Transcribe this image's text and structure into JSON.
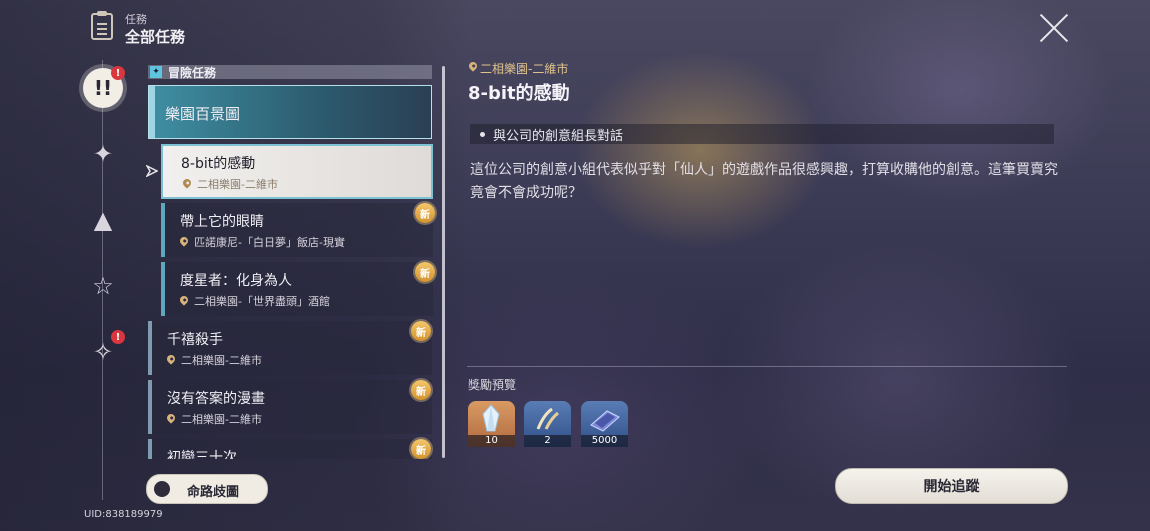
{
  "header": {
    "subtitle": "任務",
    "title": "全部任務"
  },
  "sidebar": [
    {
      "icon": "exclamation-icon",
      "glyph": "!!",
      "active": true,
      "alert": "!"
    },
    {
      "icon": "diamond-star-icon",
      "glyph": "✦",
      "active": false,
      "alert": ""
    },
    {
      "icon": "triangle-icon",
      "glyph": "▲",
      "active": false,
      "alert": ""
    },
    {
      "icon": "star-icon",
      "glyph": "☆",
      "active": false,
      "alert": ""
    },
    {
      "icon": "sparkle-icon",
      "glyph": "✧",
      "active": false,
      "alert": "!"
    }
  ],
  "list": {
    "section": "冒險任務",
    "items": [
      {
        "title": "樂園百景圖",
        "location": "",
        "new": false
      },
      {
        "title": "8-bit的感動",
        "location": "二相樂園-二維市",
        "new": false
      },
      {
        "title": "帶上它的眼睛",
        "location": "匹諾康尼-「白日夢」飯店-現實",
        "new": true,
        "badge": "新"
      },
      {
        "title": "度星者：化身為人",
        "location": "二相樂園-「世界盡頭」酒館",
        "new": true,
        "badge": "新"
      },
      {
        "title": "千禧殺手",
        "location": "二相樂園-二維市",
        "new": true,
        "badge": "新"
      },
      {
        "title": "沒有答案的漫畫",
        "location": "二相樂園-二維市",
        "new": true,
        "badge": "新"
      },
      {
        "title": "初戀三十次",
        "location": "",
        "new": true,
        "badge": "新"
      }
    ]
  },
  "route_button": "命路歧圖",
  "uid": "UID:838189979",
  "detail": {
    "location": "二相樂園-二維市",
    "title": "8-bit的感動",
    "objective": "與公司的創意組長對話",
    "description": "這位公司的創意小組代表似乎對「仙人」的遊戲作品很感興趣，打算收購他的創意。這筆買賣究竟會不會成功呢？",
    "rewards_label": "獎勵預覽",
    "rewards": [
      {
        "icon": "crystal-icon",
        "count": "10"
      },
      {
        "icon": "feather-material-icon",
        "count": "2"
      },
      {
        "icon": "credit-icon",
        "count": "5000"
      }
    ],
    "track_button": "開始追蹤"
  }
}
